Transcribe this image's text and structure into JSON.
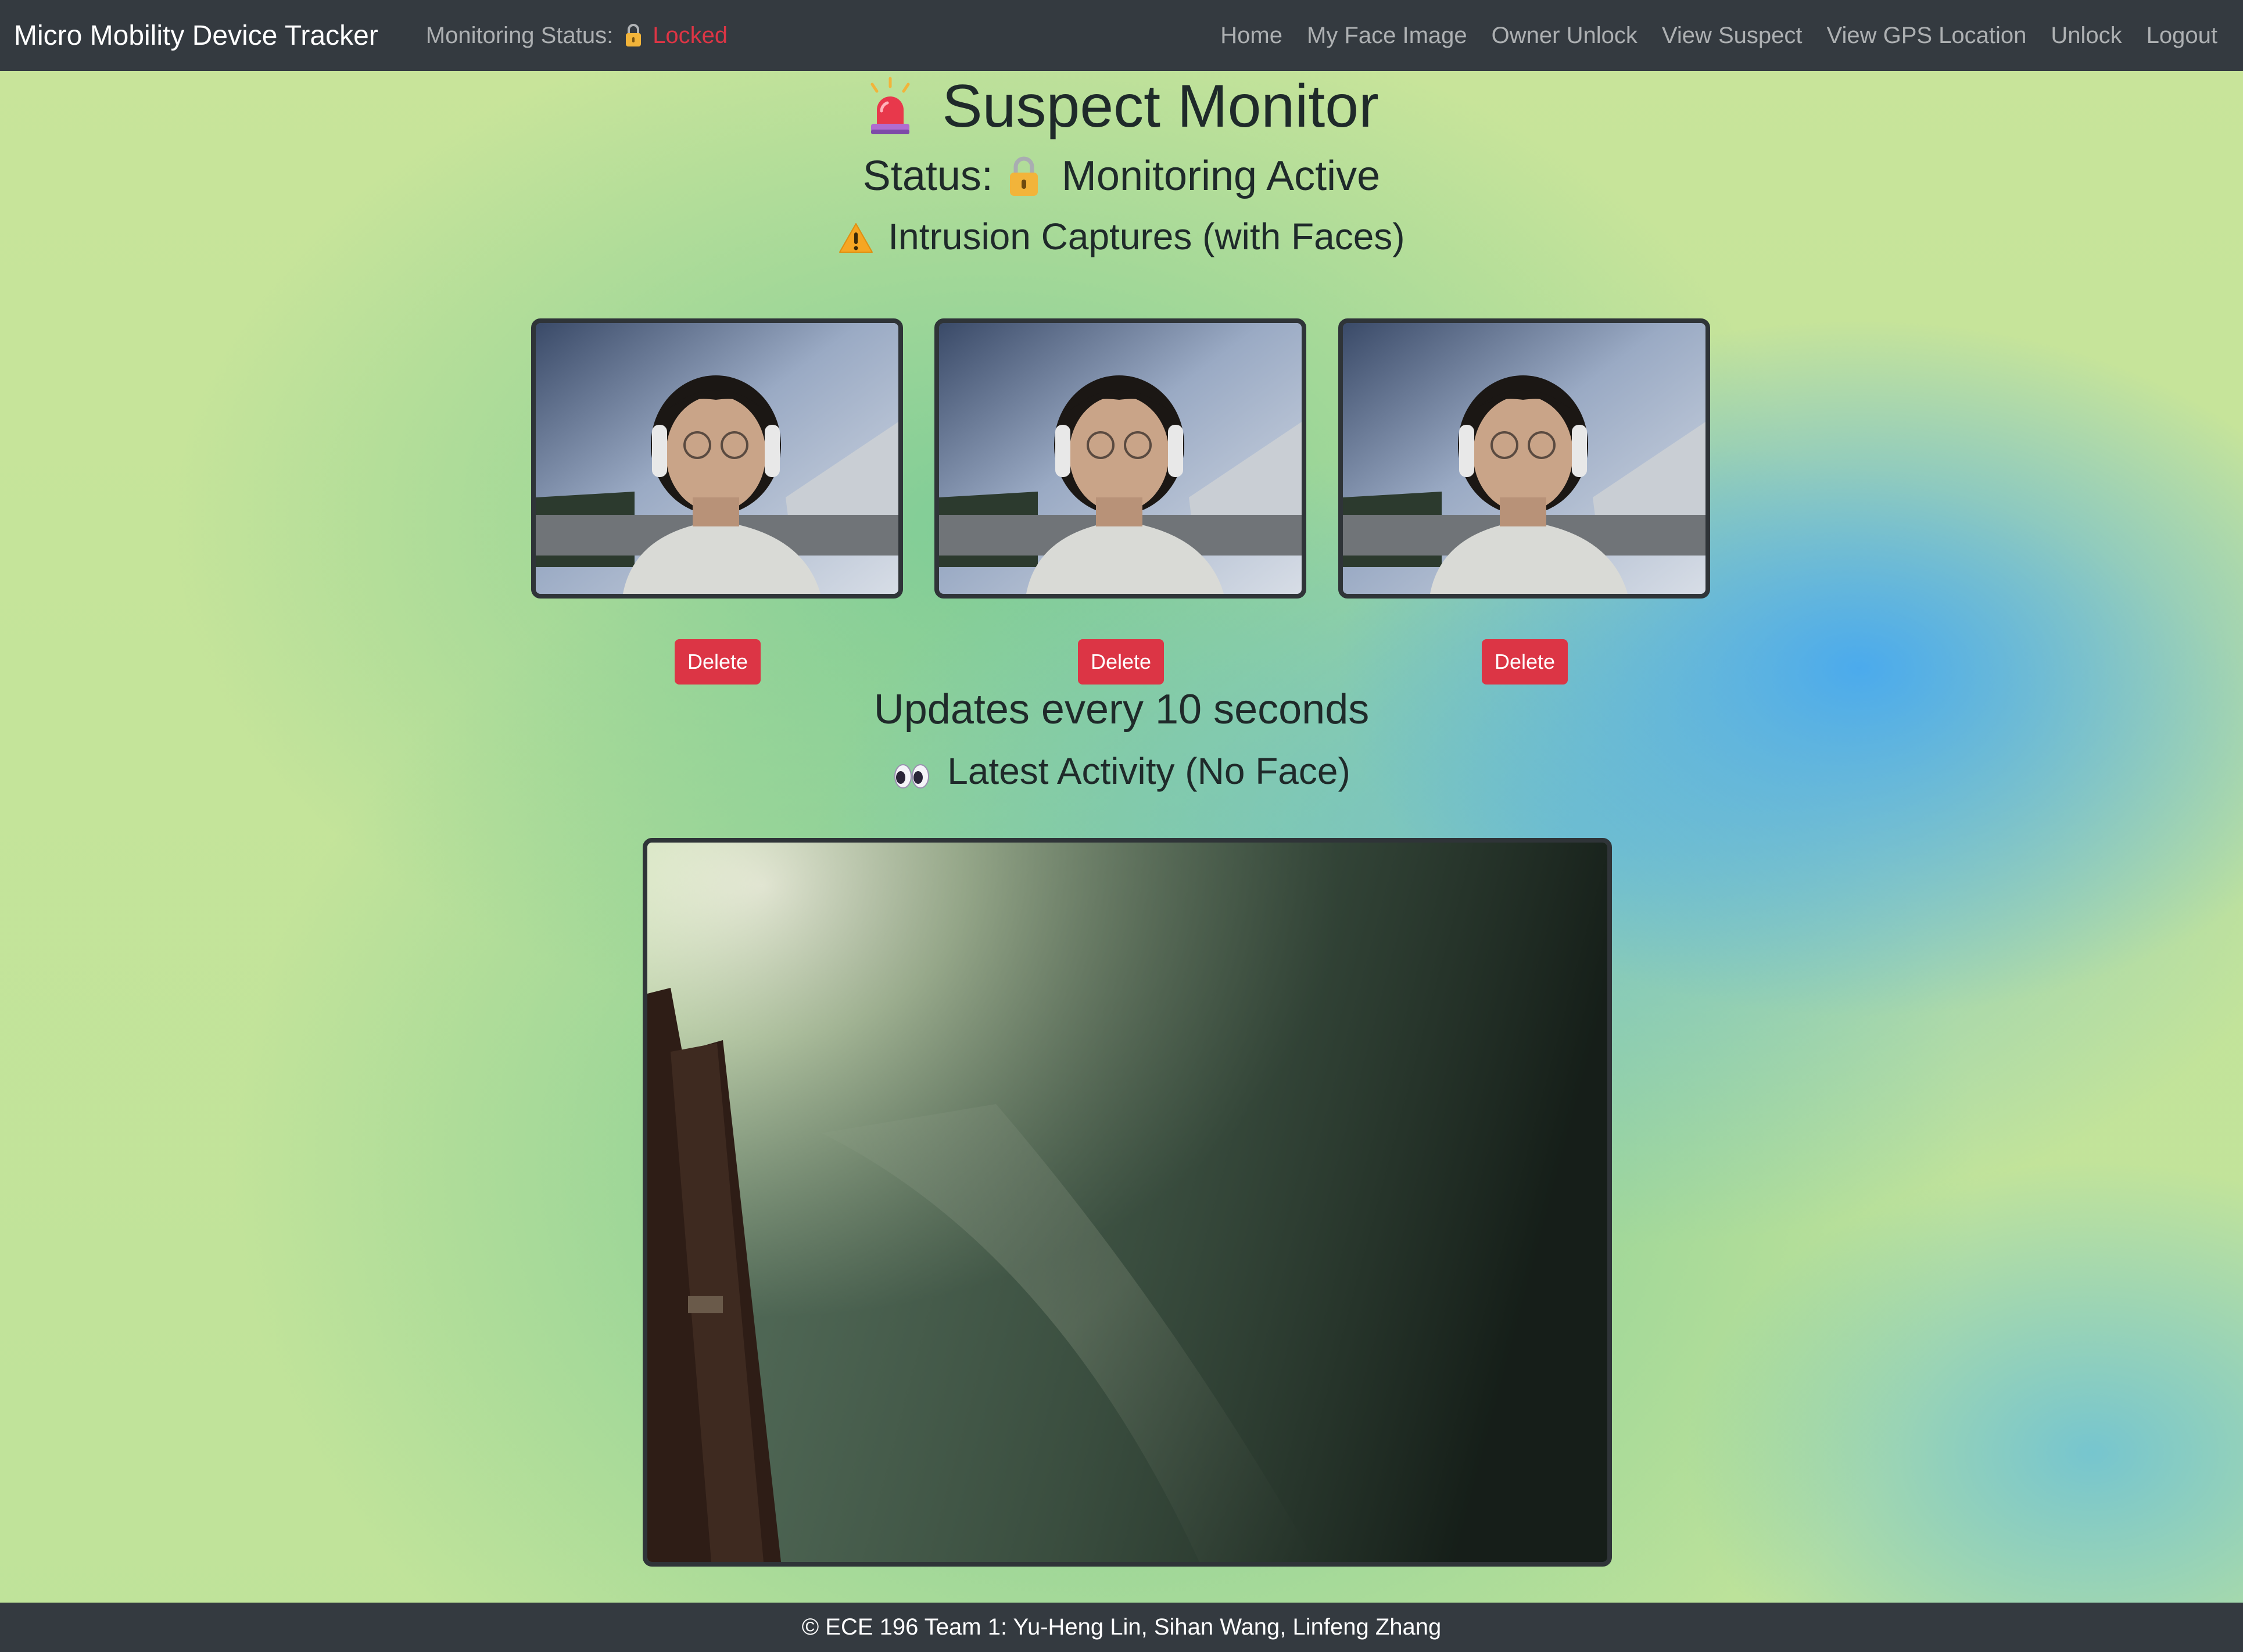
{
  "navbar": {
    "brand": "Micro Mobility Device Tracker",
    "monitoring_label": "Monitoring Status:",
    "monitoring_value": "Locked",
    "links": [
      "Home",
      "My Face Image",
      "Owner Unlock",
      "View Suspect",
      "View GPS Location",
      "Unlock",
      "Logout"
    ]
  },
  "main": {
    "title": "Suspect Monitor",
    "status_label": "Status:",
    "status_value": "Monitoring Active",
    "captures_heading": "Intrusion Captures (with Faces)",
    "delete_label": "Delete",
    "update_note": "Updates every 10 seconds",
    "latest_heading": "Latest Activity (No Face)"
  },
  "footer": {
    "text": "© ECE 196 Team 1: Yu-Heng Lin, Sihan Wang, Linfeng Zhang"
  },
  "colors": {
    "navbar_bg": "#343a40",
    "danger": "#dc3545",
    "lock_gold": "#f2b43a"
  },
  "icons": {
    "title_icon": "siren-icon",
    "status_icon": "lock-icon",
    "captures_icon": "warning-icon",
    "latest_icon": "eyes-icon"
  }
}
